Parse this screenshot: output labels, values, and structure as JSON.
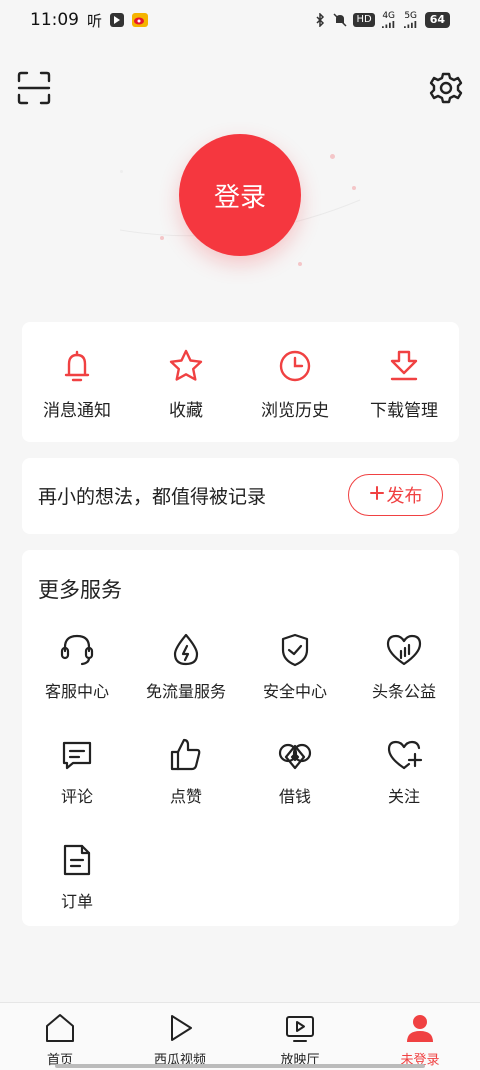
{
  "status_bar": {
    "time": "11:09",
    "left_icons": [
      "listen-app-icon",
      "notification-app-icon",
      "weibo-app-icon"
    ],
    "listen_label": "听",
    "hd_label": "HD",
    "net_4g": "4G",
    "net_5g": "5G",
    "battery": "64"
  },
  "header": {
    "scan_icon": "scan-icon",
    "settings_icon": "gear-icon"
  },
  "login": {
    "label": "登录",
    "accent": "#f5373f"
  },
  "quick_actions": [
    {
      "label": "消息通知",
      "icon": "bell-icon"
    },
    {
      "label": "收藏",
      "icon": "star-icon"
    },
    {
      "label": "浏览历史",
      "icon": "clock-icon"
    },
    {
      "label": "下载管理",
      "icon": "download-icon"
    }
  ],
  "idea": {
    "text": "再小的想法，都值得被记录",
    "publish_label": "发布"
  },
  "services": {
    "title": "更多服务",
    "items": [
      {
        "label": "客服中心",
        "icon": "headset-icon"
      },
      {
        "label": "免流量服务",
        "icon": "water-drop-icon"
      },
      {
        "label": "安全中心",
        "icon": "shield-check-icon"
      },
      {
        "label": "头条公益",
        "icon": "heart-charity-icon"
      },
      {
        "label": "评论",
        "icon": "comment-icon"
      },
      {
        "label": "点赞",
        "icon": "thumbs-up-icon"
      },
      {
        "label": "借钱",
        "icon": "loan-icon"
      },
      {
        "label": "关注",
        "icon": "heart-plus-icon"
      },
      {
        "label": "订单",
        "icon": "order-icon"
      }
    ]
  },
  "tabs": [
    {
      "label": "首页",
      "icon": "home-icon"
    },
    {
      "label": "西瓜视频",
      "icon": "play-icon"
    },
    {
      "label": "放映厅",
      "icon": "tv-play-icon"
    },
    {
      "label": "未登录",
      "icon": "user-icon",
      "active": true
    }
  ],
  "colors": {
    "accent": "#f04142",
    "icon_red": "#f04142",
    "background": "#f6f6f6"
  }
}
